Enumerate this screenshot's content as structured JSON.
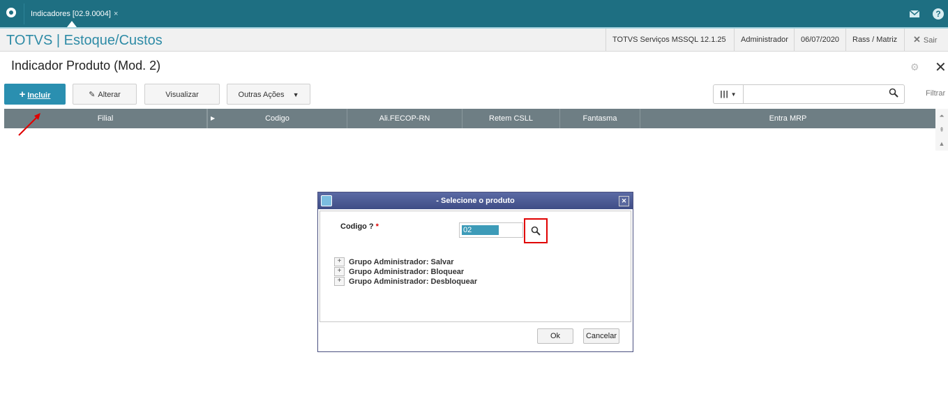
{
  "topbar": {
    "tab_label": "Indicadores [02.9.0004]",
    "tab_close": "×"
  },
  "header": {
    "module_title": "TOTVS | Estoque/Custos",
    "server": "TOTVS Serviços MSSQL 12.1.25",
    "user": "Administrador",
    "date": "06/07/2020",
    "branch": "Rass / Matriz",
    "exit_label": "Sair"
  },
  "page": {
    "title": "Indicador Produto (Mod. 2)"
  },
  "toolbar": {
    "include_label": "Incluir",
    "edit_label": "Alterar",
    "view_label": "Visualizar",
    "other_actions_label": "Outras Ações",
    "filter_label": "Filtrar",
    "search_value": ""
  },
  "grid": {
    "columns": [
      "Filial",
      "Codigo",
      "Ali.FECOP-RN",
      "Retem CSLL",
      "Fantasma",
      "Entra MRP"
    ]
  },
  "dialog": {
    "title": "- Selecione o produto",
    "field_label": "Codigo ?",
    "required_mark": "*",
    "field_value": "02",
    "tree_items": [
      "Grupo Administrador: Salvar",
      "Grupo Administrador: Bloquear",
      "Grupo Administrador: Desbloquear"
    ],
    "ok_label": "Ok",
    "cancel_label": "Cancelar"
  },
  "colors": {
    "topbar": "#1e6f82",
    "accent": "#2e8ba6",
    "primary_button": "#2a8fb0",
    "grid_header": "#6e7e84",
    "highlight": "#e00000"
  }
}
